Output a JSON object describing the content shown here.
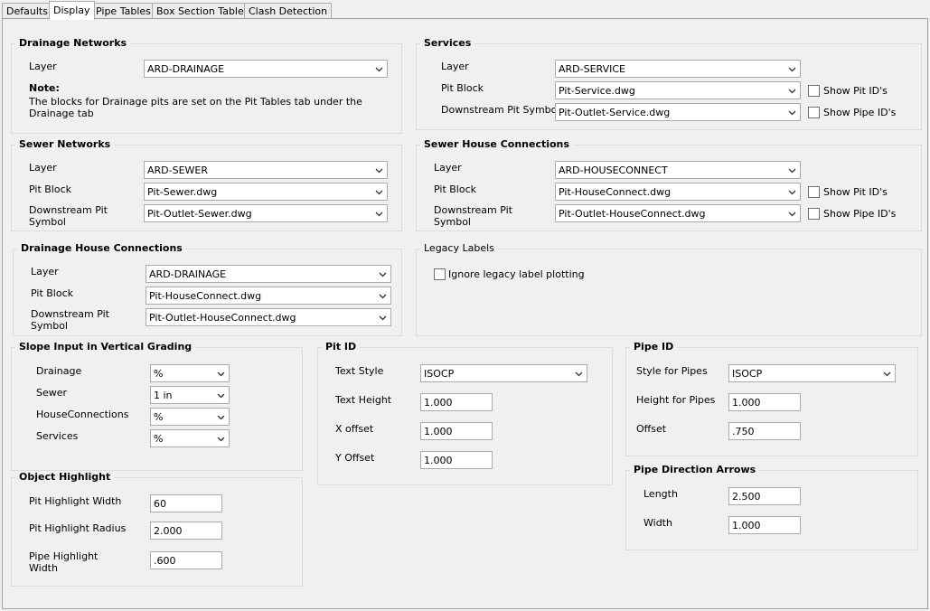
{
  "tabs": [
    "Defaults",
    "Display",
    "Pipe Tables",
    "Box Section Tables",
    "Clash Detection"
  ],
  "drainage": {
    "title": "Drainage Networks",
    "layer_label": "Layer",
    "layer_value": "ARD-DRAINAGE",
    "note_label": "Note:",
    "note_text": "The blocks for Drainage pits are set on the Pit Tables tab under the Drainage tab"
  },
  "services": {
    "title": "Services",
    "layer_label": "Layer",
    "layer_value": "ARD-SERVICE",
    "pit_block_label": "Pit Block",
    "pit_block_value": "Pit-Service.dwg",
    "downstream_label": "Downstream Pit Symbol",
    "downstream_value": "Pit-Outlet-Service.dwg",
    "show_pit_ids": "Show Pit ID's",
    "show_pipe_ids": "Show Pipe ID's"
  },
  "sewer": {
    "title": "Sewer Networks",
    "layer_label": "Layer",
    "layer_value": "ARD-SEWER",
    "pit_block_label": "Pit Block",
    "pit_block_value": "Pit-Sewer.dwg",
    "downstream_label": "Downstream Pit Symbol",
    "downstream_value": "Pit-Outlet-Sewer.dwg"
  },
  "sewer_house": {
    "title": "Sewer House Connections",
    "layer_label": "Layer",
    "layer_value": "ARD-HOUSECONNECT",
    "pit_block_label": "Pit Block",
    "pit_block_value": "Pit-HouseConnect.dwg",
    "downstream_label": "Downstream Pit Symbol",
    "downstream_value": "Pit-Outlet-HouseConnect.dwg",
    "show_pit_ids": "Show Pit ID's",
    "show_pipe_ids": "Show Pipe ID's"
  },
  "drainage_house": {
    "title": "Drainage House Connections",
    "layer_label": "Layer",
    "layer_value": "ARD-DRAINAGE",
    "pit_block_label": "Pit Block",
    "pit_block_value": "Pit-HouseConnect.dwg",
    "downstream_label": "Downstream Pit Symbol",
    "downstream_value": "Pit-Outlet-HouseConnect.dwg"
  },
  "legacy": {
    "title": "Legacy Labels",
    "ignore_label": "Ignore legacy label plotting"
  },
  "slope": {
    "title": "Slope Input in Vertical Grading",
    "drainage_label": "Drainage",
    "drainage_value": "%",
    "sewer_label": "Sewer",
    "sewer_value": "1 in",
    "house_label": "HouseConnections",
    "house_value": "%",
    "services_label": "Services",
    "services_value": "%"
  },
  "pit_id": {
    "title": "Pit ID",
    "text_style_label": "Text Style",
    "text_style_value": "ISOCP",
    "text_height_label": "Text Height",
    "text_height_value": "1.000",
    "x_offset_label": "X offset",
    "x_offset_value": "1.000",
    "y_offset_label": "Y Offset",
    "y_offset_value": "1.000"
  },
  "pipe_id": {
    "title": "Pipe ID",
    "style_label": "Style for Pipes",
    "style_value": "ISOCP",
    "height_label": "Height for Pipes",
    "height_value": "1.000",
    "offset_label": "Offset",
    "offset_value": ".750"
  },
  "highlight": {
    "title": "Object Highlight",
    "pit_width_label": "Pit Highlight Width",
    "pit_width_value": "60",
    "pit_radius_label": "Pit Highlight Radius",
    "pit_radius_value": "2.000",
    "pipe_width_label": "Pipe Highlight Width",
    "pipe_width_value": ".600"
  },
  "arrows": {
    "title": "Pipe Direction Arrows",
    "length_label": "Length",
    "length_value": "2.500",
    "width_label": "Width",
    "width_value": "1.000"
  }
}
